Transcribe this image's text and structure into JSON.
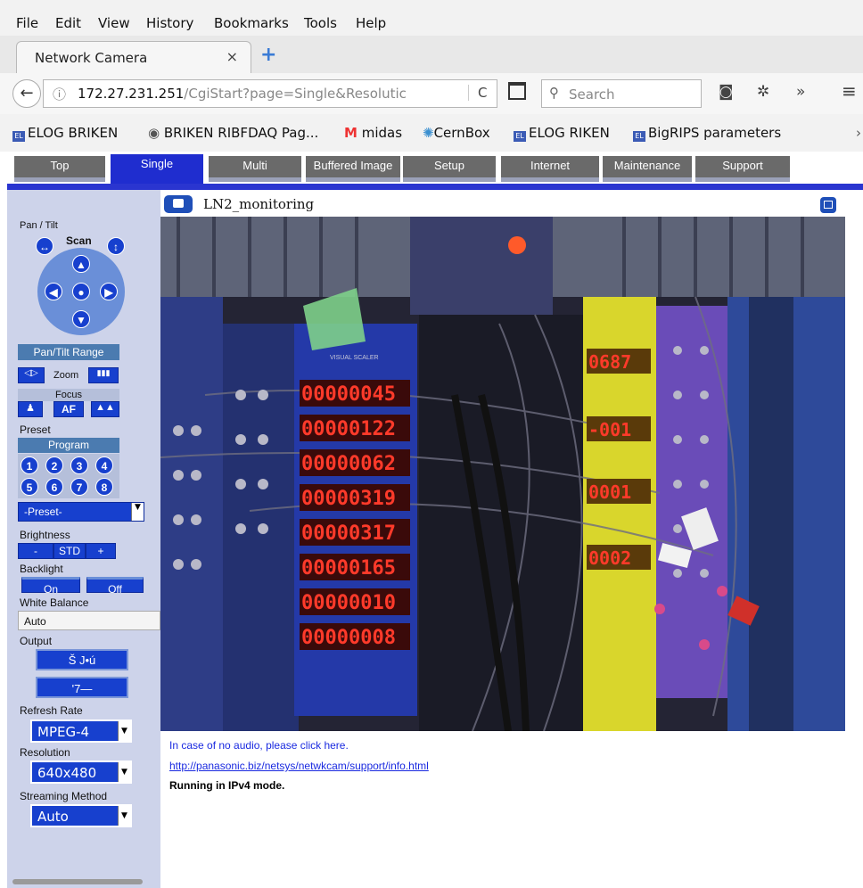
{
  "menu": [
    "File",
    "Edit",
    "View",
    "History",
    "Bookmarks",
    "Tools",
    "Help"
  ],
  "tab": {
    "title": "Network Camera",
    "close": "×",
    "new": "+"
  },
  "address": {
    "host": "172.27.231.251",
    "path": "/CgiStart?page=Single&Resolutic"
  },
  "search": {
    "placeholder": "Search"
  },
  "bookmarks": [
    "ELOG BRIKEN",
    "BRIKEN RIBFDAQ Pag...",
    "midas",
    "CernBox",
    "ELOG RIKEN",
    "BigRIPS parameters"
  ],
  "nav_tabs": [
    "Top",
    "Single",
    "Multi",
    "Buffered Image",
    "Setup",
    "Internet",
    "Maintenance",
    "Support"
  ],
  "active_tab": "Single",
  "camera_name": "LN2_monitoring",
  "controls": {
    "pan_tilt": "Pan / Tilt",
    "scan": "Scan",
    "pan_tilt_range": "Pan/Tilt Range",
    "zoom": "Zoom",
    "focus": "Focus",
    "af": "AF",
    "preset": "Preset",
    "program": "Program",
    "preset_numbers": [
      "1",
      "2",
      "3",
      "4",
      "5",
      "6",
      "7",
      "8"
    ],
    "preset_select": "-Preset-",
    "brightness": "Brightness",
    "brightness_minus": "-",
    "brightness_std": "STD",
    "brightness_plus": "+",
    "backlight": "Backlight",
    "on": "On",
    "off": "Off",
    "white_balance": "White Balance",
    "white_balance_value": "Auto",
    "output": "Output",
    "output_btn1": "Š Ј•ú",
    "output_btn2": "'7—",
    "refresh_rate": "Refresh Rate",
    "refresh_rate_value": "MPEG-4",
    "resolution": "Resolution",
    "resolution_value": "640x480",
    "streaming_method": "Streaming Method",
    "streaming_method_value": "Auto"
  },
  "video": {
    "scaler_label": "VISUAL SCALER",
    "counters": [
      "00000045",
      "00000122",
      "00000062",
      "00000319",
      "00000317",
      "00000165",
      "00000010",
      "00000008"
    ],
    "yellow_module": [
      "0687",
      "-001",
      "0001",
      "0002"
    ]
  },
  "footer": {
    "audio_note": "In case of no audio, please click here.",
    "support_link": "http://panasonic.biz/netsys/netwkcam/support/info.html",
    "mode": "Running in IPv4 mode."
  }
}
